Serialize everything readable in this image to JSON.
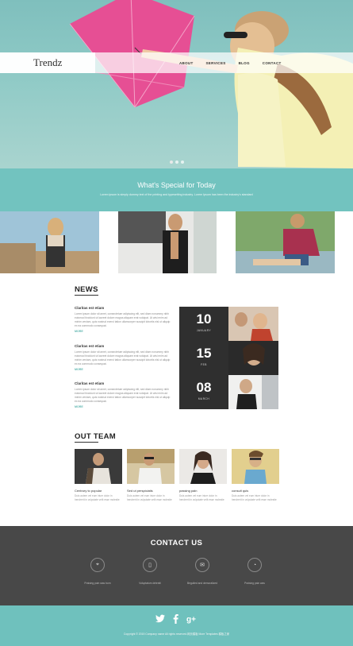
{
  "header": {
    "brand": "Trendz",
    "nav": [
      "ABOUT",
      "SERVICES",
      "BLOG",
      "CONTACT"
    ]
  },
  "special": {
    "title": "What's Special for Today",
    "text": "Lorem ipsum is simply dummy text of the printing and typesetting industry. Lorem Ipsum has been the industry's standard"
  },
  "news": {
    "title": "NEWS",
    "items": [
      {
        "heading": "Claritas est etiam",
        "text": "Lorem ipsum dolor sit amet, consectetuer adipiscing elit, sed diam nonummy nibh euismod tincidunt ut laoreet dolore magna aliquam erat volutpat. Ut wisi enim ad minim veniam, quis nostrud exerci tation ullamcorper suscipit lobortis nisl ut aliquip ex ea commodo consequat.",
        "more": "MORE"
      },
      {
        "heading": "Claritas est etiam",
        "text": "Lorem ipsum dolor sit amet, consectetuer adipiscing elit, sed diam nonummy nibh euismod tincidunt ut laoreet dolore magna aliquam erat volutpat. Ut wisi enim ad minim veniam, quis nostrud exerci tation ullamcorper suscipit lobortis nisl ut aliquip ex ea commodo consequat.",
        "more": "MORE"
      },
      {
        "heading": "Claritas est etiam",
        "text": "Lorem ipsum dolor sit amet, consectetuer adipiscing elit, sed diam nonummy nibh euismod tincidunt ut laoreet dolore magna aliquam erat volutpat. Ut wisi enim ad minim veniam, quis nostrud exerci tation ullamcorper suscipit lobortis nisl ut aliquip ex ea commodo consequat.",
        "more": "MORE"
      }
    ],
    "dates": [
      {
        "num": "10",
        "month": "JANUARY"
      },
      {
        "num": "15",
        "month": "FEB"
      },
      {
        "num": "08",
        "month": "MARCH"
      }
    ]
  },
  "team": {
    "title": "OUT TEAM",
    "members": [
      {
        "name": "Centrury to popular",
        "desc": "Duis autem vel eum iriure dolor in hendrerit in vulputate velit esse molestie"
      },
      {
        "name": "Sed ut perspiciatis",
        "desc": "Duis autem vel eum iriure dolor in hendrerit in vulputate velit esse molestie"
      },
      {
        "name": "passing pain",
        "desc": "Duis autem vel eum iriure dolor in hendrerit in vulputate velit esse molestie"
      },
      {
        "name": "consult quis",
        "desc": "Duis autem vel eum iriure dolor in hendrerit in vulputate velit esse molestie"
      }
    ]
  },
  "contact": {
    "title": "CONTACT US",
    "items": [
      {
        "icon": "location-icon",
        "glyph": "⌖",
        "label": "Praising pain was born"
      },
      {
        "icon": "phone-icon",
        "glyph": "▯",
        "label": "Voluptatum deleniti"
      },
      {
        "icon": "mail-icon",
        "glyph": "✉",
        "label": "Beguiled and demoralized"
      },
      {
        "icon": "time-icon",
        "glyph": "◔",
        "label": "Praising pain was"
      }
    ]
  },
  "footer": {
    "social": [
      "twitter-icon",
      "facebook-icon",
      "googleplus-icon"
    ],
    "copyright": "Copyright © 2015 Company name All rights reserved.网页模板 More Templates 模板之家"
  },
  "colors": {
    "accent": "#72c3bf",
    "dark": "#484848",
    "footer": "#6fc1bd"
  }
}
